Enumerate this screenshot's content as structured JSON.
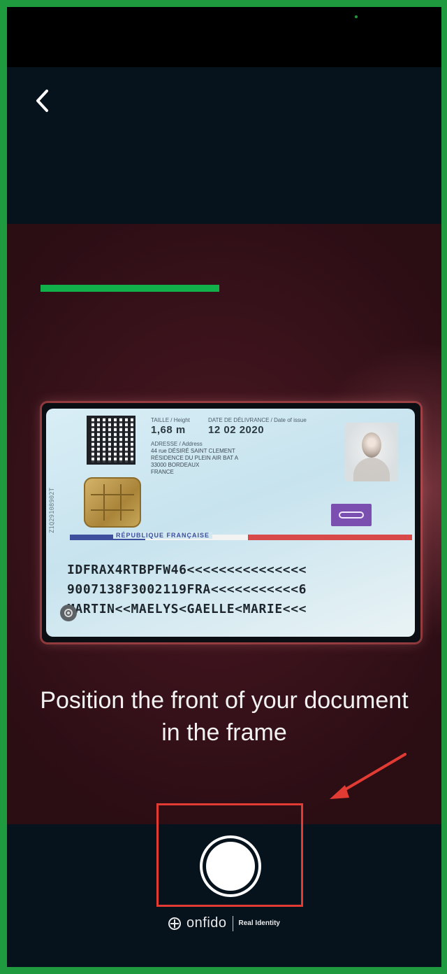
{
  "nav": {
    "back_icon": "chevron-left-icon"
  },
  "id_card": {
    "serial": "Z1Q29108902T",
    "height_label": "TAILLE / Height",
    "height_value": "1,68 m",
    "issue_label": "DATE DE DÉLIVRANCE / Date of issue",
    "issue_value": "12 02 2020",
    "address_label": "ADRESSE / Address",
    "address_lines": [
      "44 rue DÉSIRÉ SAINT CLEMENT",
      "RÉSIDENCE DU PLEIN AIR BAT A",
      "33000 BORDEAUX",
      "FRANCE"
    ],
    "republic": "RÉPUBLIQUE FRANÇAISE",
    "mrz": [
      "IDFRAX4RTBPFW46<<<<<<<<<<<<<<<",
      "9007138F3002119FRA<<<<<<<<<<<6",
      "MARTIN<<MAELYS<GAELLE<MARIE<<<"
    ]
  },
  "instruction": {
    "line1": "Position the front of your document",
    "line2": "in the frame"
  },
  "capture": {
    "button_icon": "shutter-icon"
  },
  "brand": {
    "name": "onfido",
    "tagline": "Real Identity"
  },
  "colors": {
    "frame_green": "#1f9a3f",
    "highlight_green": "#12b04a",
    "annotation_red": "#e23b34",
    "background_dark": "#06121c"
  }
}
